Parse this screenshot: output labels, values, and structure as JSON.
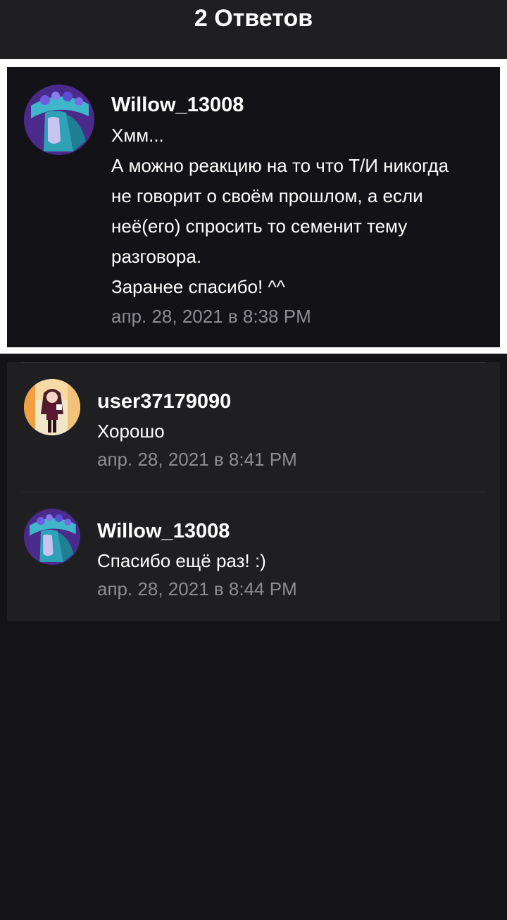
{
  "header": {
    "title": "2 Ответов"
  },
  "original_post": {
    "username": "Willow_13008",
    "lines": [
      "Хмм...",
      "А можно реакцию на то что Т/И никогда",
      "не говорит о своём прошлом, а если",
      "неё(его) спросить то семенит тему",
      "разговора.",
      "Заранее спасибо! ^^"
    ],
    "timestamp": "апр. 28, 2021 в 8:38 PM",
    "avatar_icon": "avatar-willow-icon"
  },
  "replies": [
    {
      "username": "user37179090",
      "text": "Хорошо",
      "timestamp": "апр. 28, 2021 в 8:41 PM",
      "avatar_icon": "avatar-user-icon"
    },
    {
      "username": "Willow_13008",
      "text": "Спасибо ещё раз! :)",
      "timestamp": "апр. 28, 2021 в 8:44 PM",
      "avatar_icon": "avatar-willow-icon"
    }
  ],
  "colors": {
    "background": "#141316",
    "header": "#1f1e21",
    "card": "#1f1e21",
    "op_card": "#131216",
    "timestamp": "#8e8c92"
  }
}
